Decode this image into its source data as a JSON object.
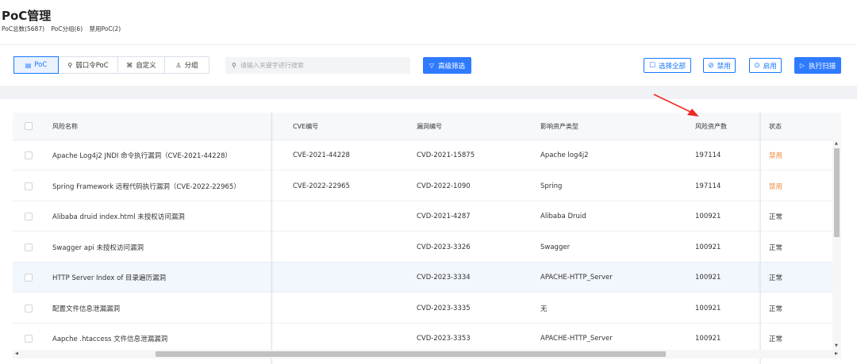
{
  "header": {
    "title": "PoC管理",
    "stats": [
      "PoC总数(5687)",
      "PoC分组(6)",
      "禁用PoC(2)"
    ]
  },
  "toolbar": {
    "tabs": [
      {
        "label": "PoC",
        "icon": "poc-icon",
        "glyph": "▤"
      },
      {
        "label": "弱口令PoC",
        "icon": "key-icon",
        "glyph": "⚲"
      },
      {
        "label": "自定义",
        "icon": "custom-icon",
        "glyph": "⌘"
      },
      {
        "label": "分组",
        "icon": "group-icon",
        "glyph": "♙"
      }
    ],
    "search_placeholder": "请输入关键字进行搜索",
    "advanced_filter": "高级筛选",
    "select_all": "选择全部",
    "disable": "禁用",
    "enable": "启用",
    "run_scan": "执行扫描"
  },
  "table": {
    "columns": [
      "风险名称",
      "CVE编号",
      "漏洞编号",
      "影响资产类型",
      "风险资产数",
      "状态"
    ],
    "rows": [
      {
        "name": "Apache Log4j2 JNDI 命令执行漏洞（CVE-2021-44228）",
        "cve": "CVE-2021-44228",
        "vul": "CVD-2021-15875",
        "type": "Apache log4j2",
        "count": "197114",
        "status": "禁用"
      },
      {
        "name": "Spring Framework 远程代码执行漏洞（CVE-2022-22965）",
        "cve": "CVE-2022-22965",
        "vul": "CVD-2022-1090",
        "type": "Spring",
        "count": "197114",
        "status": "禁用"
      },
      {
        "name": "Alibaba druid index.html 未授权访问漏洞",
        "cve": "",
        "vul": "CVD-2021-4287",
        "type": "Alibaba Druid",
        "count": "100921",
        "status": "正常"
      },
      {
        "name": "Swagger api 未授权访问漏洞",
        "cve": "",
        "vul": "CVD-2023-3326",
        "type": "Swagger",
        "count": "100921",
        "status": "正常"
      },
      {
        "name": "HTTP Server Index of 目录遍历漏洞",
        "cve": "",
        "vul": "CVD-2023-3334",
        "type": "APACHE-HTTP_Server",
        "count": "100921",
        "status": "正常"
      },
      {
        "name": "配置文件信息泄漏漏洞",
        "cve": "",
        "vul": "CVD-2023-3335",
        "type": "无",
        "count": "100921",
        "status": "正常"
      },
      {
        "name": "Aapche .htaccess 文件信息泄漏漏洞",
        "cve": "",
        "vul": "CVD-2023-3353",
        "type": "APACHE-HTTP_Server",
        "count": "100921",
        "status": "正常"
      }
    ]
  },
  "colors": {
    "accent": "#1677ff",
    "disabled_status": "#f08a3c",
    "annotation_arrow": "#ee2a24"
  }
}
